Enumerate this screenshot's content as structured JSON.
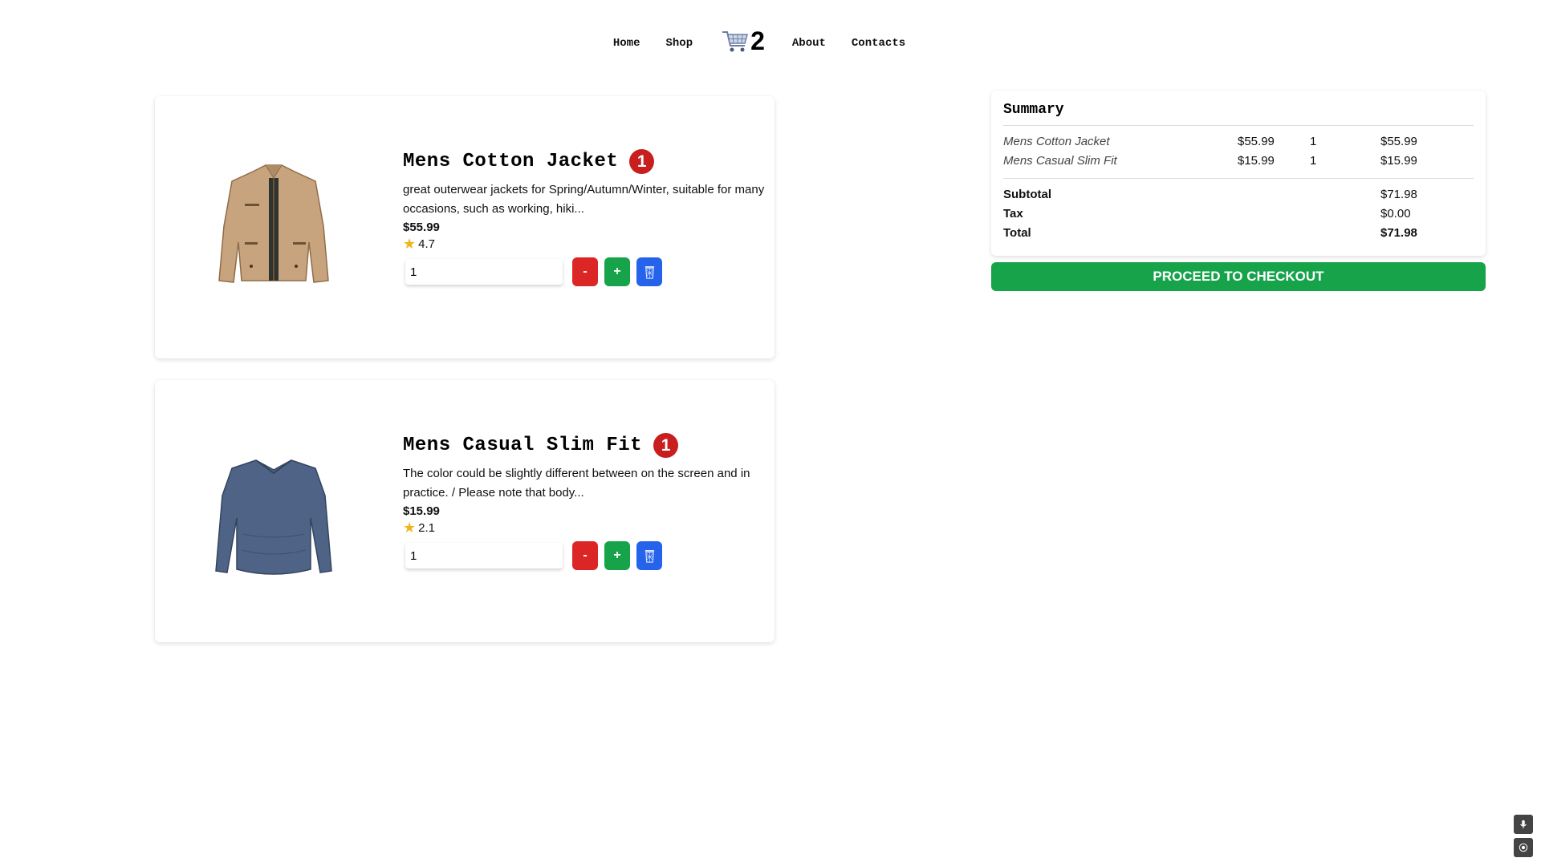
{
  "nav": {
    "home": "Home",
    "shop": "Shop",
    "cart_count": "2",
    "about": "About",
    "contacts": "Contacts"
  },
  "products": [
    {
      "title": "Mens Cotton Jacket",
      "badge": "1",
      "description": "great outerwear jackets for Spring/Autumn/Winter, suitable for many occasions, such as working, hiki...",
      "price": "$55.99",
      "rating": "4.7",
      "quantity": "1",
      "minus_label": "-",
      "plus_label": "+",
      "image_icon": "jacket-image"
    },
    {
      "title": "Mens Casual Slim Fit",
      "badge": "1",
      "description": "The color could be slightly different between on the screen and in practice. / Please note that body...",
      "price": "$15.99",
      "rating": "2.1",
      "quantity": "1",
      "minus_label": "-",
      "plus_label": "+",
      "image_icon": "shirt-image"
    }
  ],
  "summary": {
    "title": "Summary",
    "items": [
      {
        "name": "Mens Cotton Jacket",
        "price": "$55.99",
        "qty": "1",
        "total": "$55.99"
      },
      {
        "name": "Mens Casual Slim Fit",
        "price": "$15.99",
        "qty": "1",
        "total": "$15.99"
      }
    ],
    "subtotal_label": "Subtotal",
    "subtotal": "$71.98",
    "tax_label": "Tax",
    "tax": "$0.00",
    "total_label": "Total",
    "total": "$71.98",
    "checkout_label": "PROCEED TO CHECKOUT"
  },
  "colors": {
    "badge": "#c81e1e",
    "minus": "#dc2626",
    "plus": "#16a34a",
    "delete": "#2563eb",
    "checkout": "#16a34a",
    "star": "#f1b51c"
  }
}
